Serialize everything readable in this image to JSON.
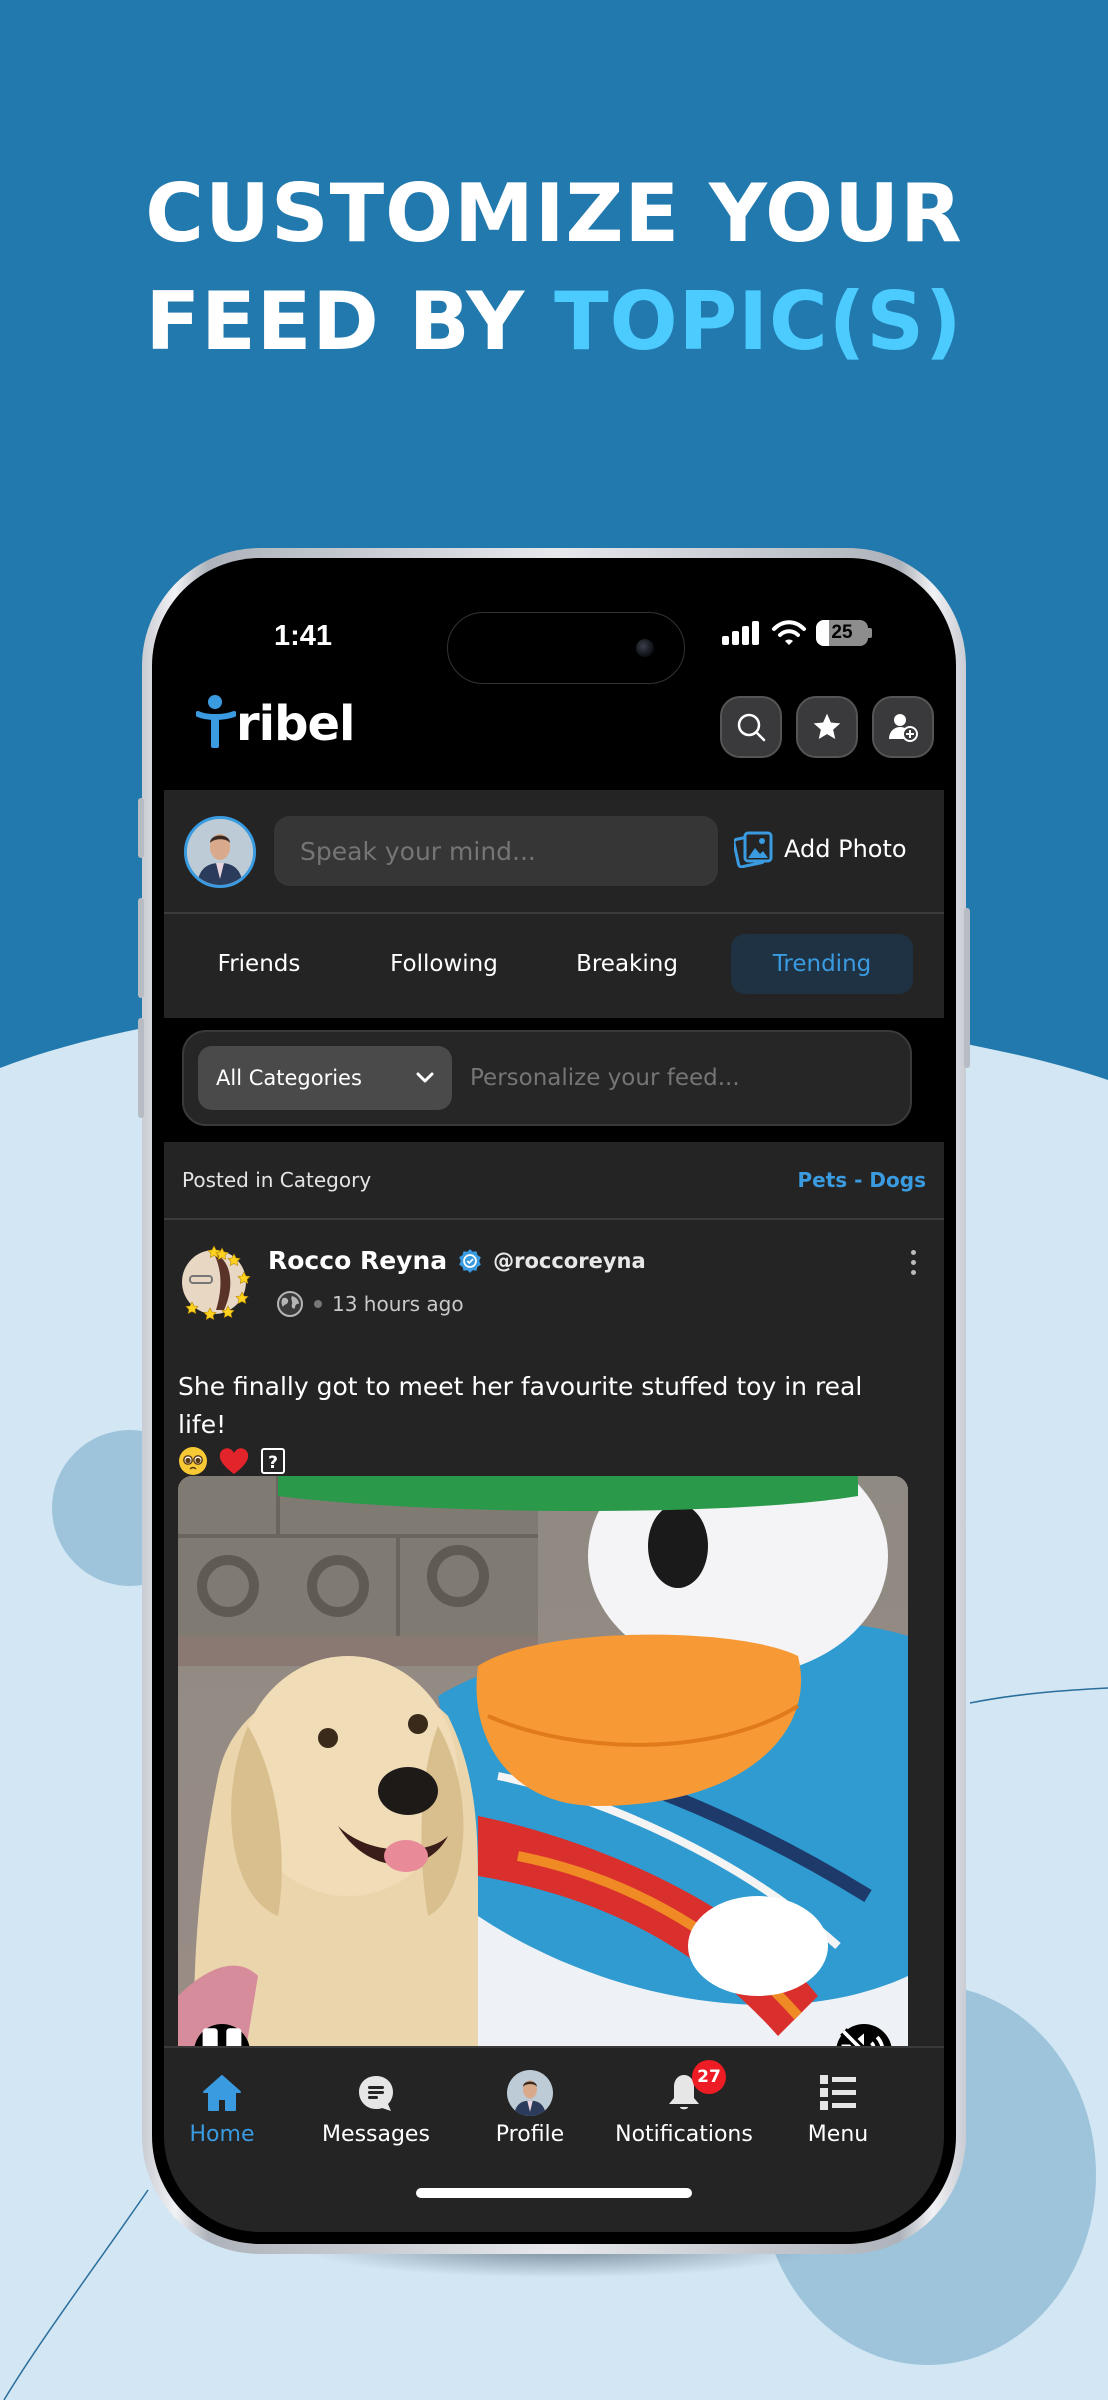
{
  "headline": {
    "line1": "CUSTOMIZE YOUR",
    "line2_prefix": "FEED BY ",
    "line2_accent": "TOPIC(S)"
  },
  "colors": {
    "brand_blue": "#3a9be0",
    "headline_accent": "#4ccbff",
    "bg_dark_blue": "#2279ad",
    "bg_light_blue": "#d2e6f3",
    "badge_red": "#ee1c25"
  },
  "status_bar": {
    "time": "1:41",
    "battery_level": "25",
    "battery_fraction": 0.25,
    "icons": [
      "signal-icon",
      "wifi-icon",
      "battery-icon"
    ]
  },
  "app_header": {
    "logo_text": "ribel",
    "logo_full": "Tribel",
    "buttons": [
      {
        "name": "search-button",
        "icon": "search-icon"
      },
      {
        "name": "favorites-button",
        "icon": "star-icon"
      },
      {
        "name": "add-friend-button",
        "icon": "user-plus-icon"
      }
    ]
  },
  "composer": {
    "placeholder": "Speak your mind...",
    "add_photo_label": "Add Photo"
  },
  "tabs": [
    {
      "label": "Friends",
      "active": false
    },
    {
      "label": "Following",
      "active": false
    },
    {
      "label": "Breaking",
      "active": false
    },
    {
      "label": "Trending",
      "active": true
    }
  ],
  "filter": {
    "category_selected": "All Categories",
    "placeholder": "Personalize your feed..."
  },
  "post": {
    "category_label": "Posted in Category",
    "category_value": "Pets - Dogs",
    "author_name": "Rocco Reyna",
    "author_handle": "@roccoreyna",
    "verified": true,
    "visibility_icon": "globe-icon",
    "time_ago": "13 hours ago",
    "text": "She finally got to meet her favourite stuffed toy in real life!",
    "emojis": [
      "🥺",
      "❤️",
      "?"
    ],
    "video": {
      "playing": true,
      "muted": true
    }
  },
  "bottom_nav": [
    {
      "label": "Home",
      "icon": "home-icon",
      "active": true
    },
    {
      "label": "Messages",
      "icon": "message-icon",
      "active": false
    },
    {
      "label": "Profile",
      "icon": "profile-avatar",
      "active": false
    },
    {
      "label": "Notifications",
      "icon": "bell-icon",
      "active": false,
      "badge": "27"
    },
    {
      "label": "Menu",
      "icon": "menu-list-icon",
      "active": false
    }
  ]
}
